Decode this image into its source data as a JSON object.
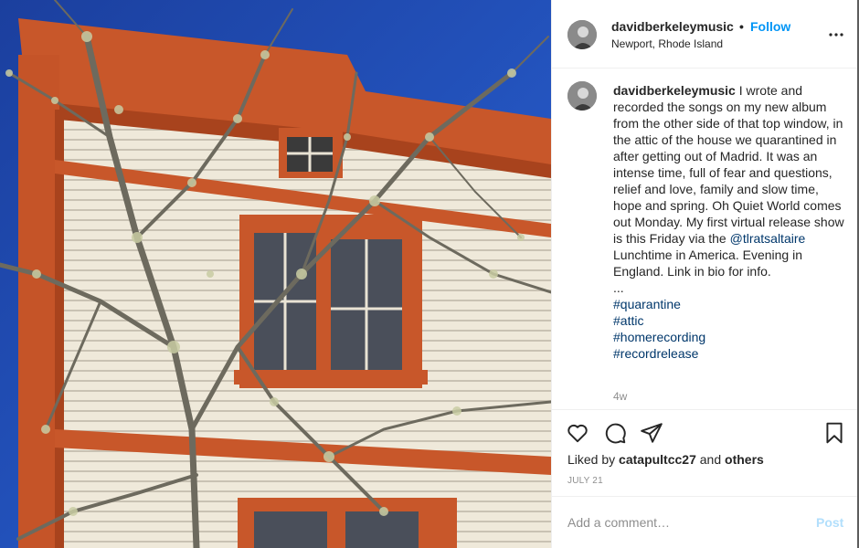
{
  "post": {
    "username": "davidberkeleymusic",
    "separator": "•",
    "follow_label": "Follow",
    "location": "Newport, Rhode Island",
    "more_icon": "more-horizontal-icon",
    "caption": {
      "username": "davidberkeleymusic",
      "text_before_mention": " I wrote and recorded the songs on my new album from the other side of that top window, in the attic of the house we quarantined in after getting out of Madrid. It was an intense time, full of fear and questions, relief and love, family and slow time, hope and spring. Oh Quiet World comes out Monday. My first virtual release show is this Friday via the ",
      "mention": "@tlratsaltaire",
      "text_after_mention": " Lunchtime in America. Evening in England. Link in bio for info.",
      "ellipsis": "...",
      "hashtags": [
        "#quarantine",
        "#attic",
        "#homerecording",
        "#recordrelease"
      ]
    },
    "time_ago": "4w",
    "likes": {
      "prefix": "Liked by ",
      "user": "catapultcc27",
      "middle": " and ",
      "others": "others"
    },
    "date": "JULY 21",
    "comment_placeholder": "Add a comment…",
    "post_label": "Post",
    "icons": {
      "like": "heart-icon",
      "comment": "comment-icon",
      "share": "paper-plane-icon",
      "save": "bookmark-icon"
    },
    "colors": {
      "link_blue": "#0095f6",
      "hashtag_blue": "#00376b",
      "muted": "#8e8e8e",
      "post_disabled": "#b2dffc",
      "sky": "#1f4fb8",
      "trim_orange": "#c8572a",
      "siding_cream": "#efe8d8"
    }
  }
}
